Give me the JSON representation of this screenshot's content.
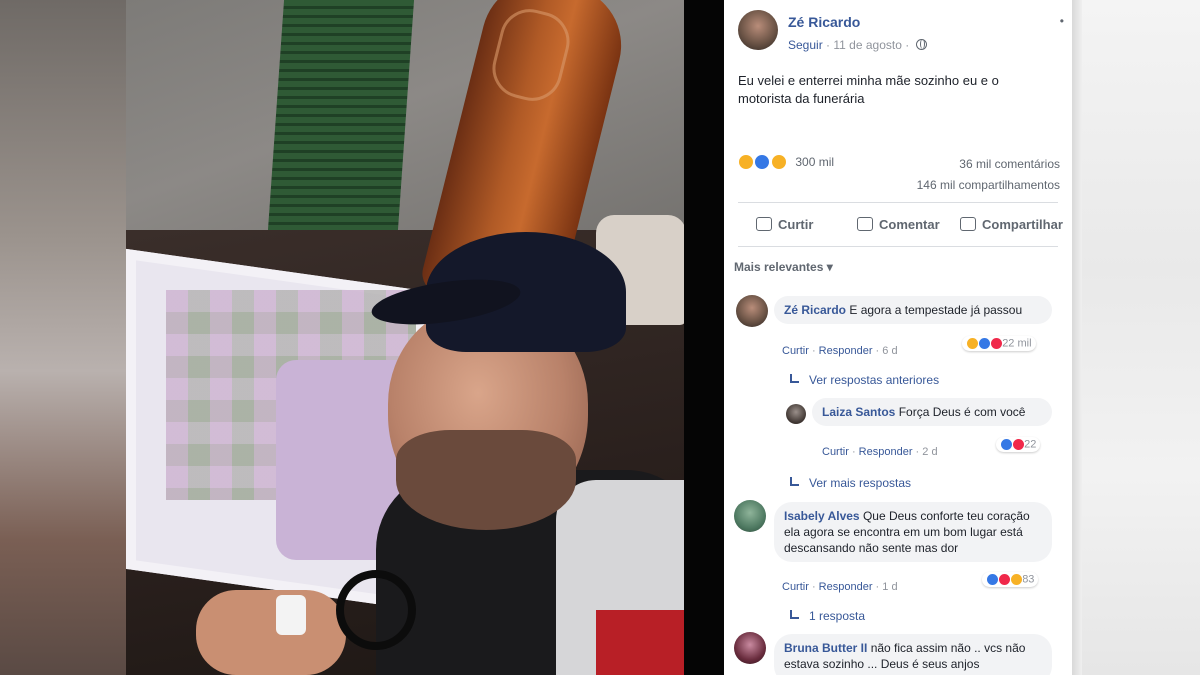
{
  "post": {
    "author": "Zé Ricardo",
    "follow_label": "Seguir",
    "date": "11 de agosto",
    "text": "Eu velei e enterrei minha mãe sozinho eu e o motorista da funerária",
    "reaction_icons": [
      "sad-icon",
      "like-icon",
      "wow-icon"
    ],
    "reaction_count": "300 mil",
    "comments_count": "36 mil comentários",
    "shares_count": "146 mil compartilhamentos"
  },
  "actions": {
    "like": "Curtir",
    "comment": "Comentar",
    "share": "Compartilhar"
  },
  "sort_label": "Mais relevantes ▾",
  "comments": [
    {
      "name": "Zé Ricardo",
      "text": "E agora a tempestade já passou",
      "like": "Curtir",
      "reply": "Responder",
      "time": "6 d",
      "reaction_count": "22 mil"
    },
    {
      "name": "Laiza Santos",
      "text": "Força Deus é com você",
      "like": "Curtir",
      "reply": "Responder",
      "time": "2 d",
      "reaction_count": "22"
    },
    {
      "name": "Isabely Alves",
      "text": "Que Deus conforte teu coração ela agora se encontra em um bom lugar está descansando não sente mas dor",
      "like": "Curtir",
      "reply": "Responder",
      "time": "1 d",
      "reaction_count": "83"
    },
    {
      "name": "Bruna Butter II",
      "text": "não fica assim não .. vcs não estava sozinho ... Deus é seus anjos"
    }
  ],
  "reply_links": {
    "previous": "Ver respostas anteriores",
    "more": "Ver mais respostas",
    "one": "1 resposta"
  },
  "colors": {
    "link_blue": "#385898",
    "like_blue": "#3578e5",
    "love_red": "#f0284a",
    "wow_yellow": "#f7b125"
  }
}
